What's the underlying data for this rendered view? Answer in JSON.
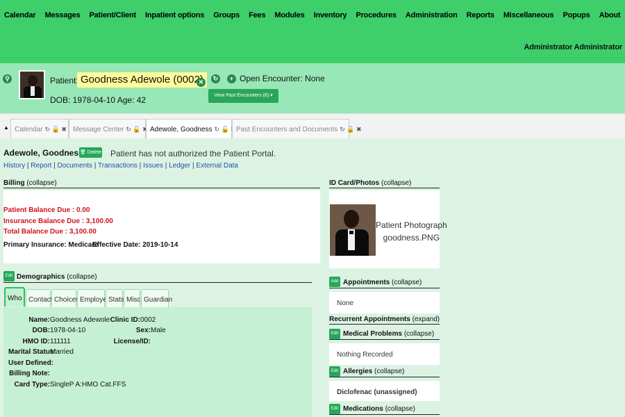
{
  "menu": [
    "Calendar",
    "Messages",
    "Patient/Client",
    "Inpatient options",
    "Groups",
    "Fees",
    "Modules",
    "Inventory",
    "Procedures",
    "Administration",
    "Reports",
    "Miscellaneous",
    "Popups",
    "About"
  ],
  "user": "Administrator Administrator",
  "header": {
    "patient_label": "Patient:",
    "patient_name": "Goodness Adewole (0002)",
    "dob": "DOB: 1978-04-10 Age: 42",
    "open_encounter": "Open Encounter: None",
    "past_encounters_btn": "View Past Encounters  (6) ▾"
  },
  "tabs": [
    {
      "label": "Calendar"
    },
    {
      "label": "Message Center"
    },
    {
      "label": "Adewole, Goodness"
    },
    {
      "label": "Past Encounters and Documents"
    }
  ],
  "summary": {
    "name": "Adewole, Goodness",
    "delete_label": "🗑 Delete",
    "portal_msg": "Patient has not authorized the Patient Portal.",
    "links": [
      "History",
      "Report",
      "Documents",
      "Transactions",
      "Issues",
      "Ledger",
      "External Data"
    ]
  },
  "billing": {
    "title": "Billing",
    "collapse": "(collapse)",
    "patient_balance": "Patient Balance Due : 0.00",
    "insurance_balance": "Insurance Balance Due : 3,100.00",
    "total_balance": "Total Balance Due : 3,100.00",
    "primary_insurance": "Primary Insurance: Medicare",
    "effective_date": "Effective Date: 2019-10-14"
  },
  "demographics": {
    "edit": "Edit",
    "title": "Demographics",
    "collapse": "(collapse)",
    "tabs": [
      "Who",
      "Contact",
      "Choices",
      "Employer",
      "Stats",
      "Misc",
      "Guardian"
    ],
    "name_label": "Name:",
    "name_value": "Goodness  Adewole",
    "clinic_label": "Clinic ID:",
    "clinic_value": "0002",
    "dob_label": "DOB:",
    "dob_value": "1978-04-10",
    "sex_label": "Sex:",
    "sex_value": "Male",
    "hmo_label": "HMO ID:",
    "hmo_value": "111111",
    "license_label": "License/ID:",
    "marital_label": "Marital Status:",
    "marital_value": "Married",
    "userdef_label": "User Defined:",
    "billnote_label": "Billing Note:",
    "card_label": "Card Type:",
    "card_value": "SingleP A:HMO Cat.FFS"
  },
  "right": {
    "idcard_title": "ID Card/Photos",
    "idcard_collapse": "(collapse)",
    "photo_caption_1": "Patient Photograph",
    "photo_caption_2": "goodness.PNG",
    "add": "Add",
    "appointments_title": "Appointments",
    "appointments_collapse": "(collapse)",
    "appointments_value": "None",
    "recurrent_title": "Recurrent Appointments",
    "recurrent_expand": "(expand)",
    "edit": "Edit",
    "medical_title": "Medical Problems",
    "medical_collapse": "(collapse)",
    "medical_value": "Nothing Recorded",
    "allergies_title": "Allergies",
    "allergies_collapse": "(collapse)",
    "allergies_value": "Diclofenac (unassigned)",
    "medications_title": "Medications",
    "medications_collapse": "(collapse)"
  }
}
